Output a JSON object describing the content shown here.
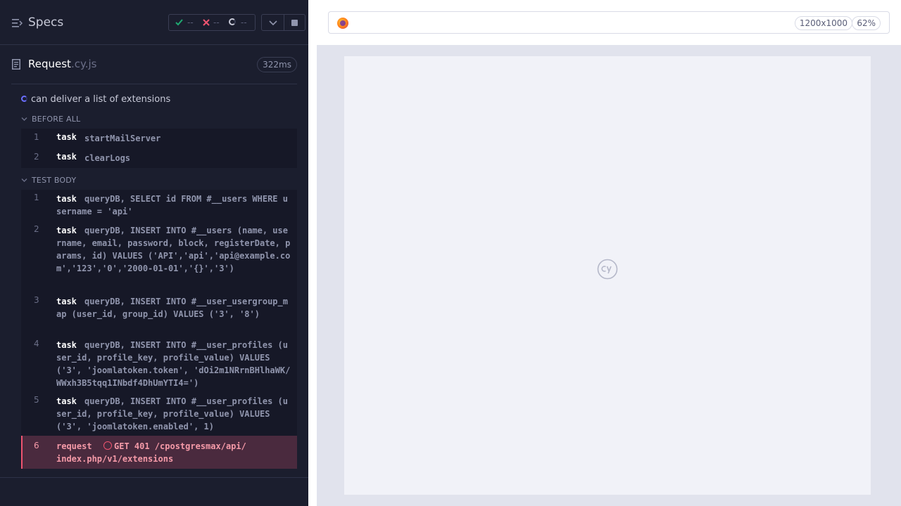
{
  "header": {
    "title": "Specs",
    "passed": "--",
    "failed": "--",
    "pending": "--"
  },
  "spec": {
    "name": "Request",
    "ext": ".cy.js",
    "duration": "322ms"
  },
  "test": {
    "title": "can deliver a list of extensions"
  },
  "before_all": {
    "label": "BEFORE ALL",
    "commands": [
      {
        "num": "1",
        "name": "task",
        "msg": "startMailServer"
      },
      {
        "num": "2",
        "name": "task",
        "msg": "clearLogs"
      }
    ]
  },
  "test_body": {
    "label": "TEST BODY",
    "commands": [
      {
        "num": "1",
        "name": "task",
        "msg": "queryDB, SELECT id FROM #__users WHERE username = 'api'"
      },
      {
        "num": "2",
        "name": "task",
        "msg": "queryDB, INSERT INTO #__users (name, username, email, password, block, registerDate, params, id) VALUES ('API','api','api@example.com','123','0','2000-01-01','{}','3')"
      },
      {
        "num": "3",
        "name": "task",
        "msg": "queryDB, INSERT INTO #__user_usergroup_map (user_id, group_id) VALUES ('3', '8')"
      },
      {
        "num": "4",
        "name": "task",
        "msg": "queryDB, INSERT INTO #__user_profiles (user_id, profile_key, profile_value) VALUES ('3', 'joomlatoken.token', 'dOi2m1NRrnBHlhaWK/WWxh3B5tqq1INbdf4DhUmYTI4=')"
      },
      {
        "num": "5",
        "name": "task",
        "msg": "queryDB, INSERT INTO #__user_profiles (user_id, profile_key, profile_value) VALUES ('3', 'joomlatoken.enabled', 1)"
      }
    ],
    "failed": {
      "num": "6",
      "name": "request",
      "msg_line1": "GET 401 /cpostgresmax/api/",
      "msg_line2": "index.php/v1/extensions"
    }
  },
  "browser": {
    "viewport": "1200x1000",
    "zoom": "62%"
  },
  "colors": {
    "accent_pass": "#1fa971",
    "accent_fail": "#f05470",
    "accent_running": "#6b6fff"
  }
}
